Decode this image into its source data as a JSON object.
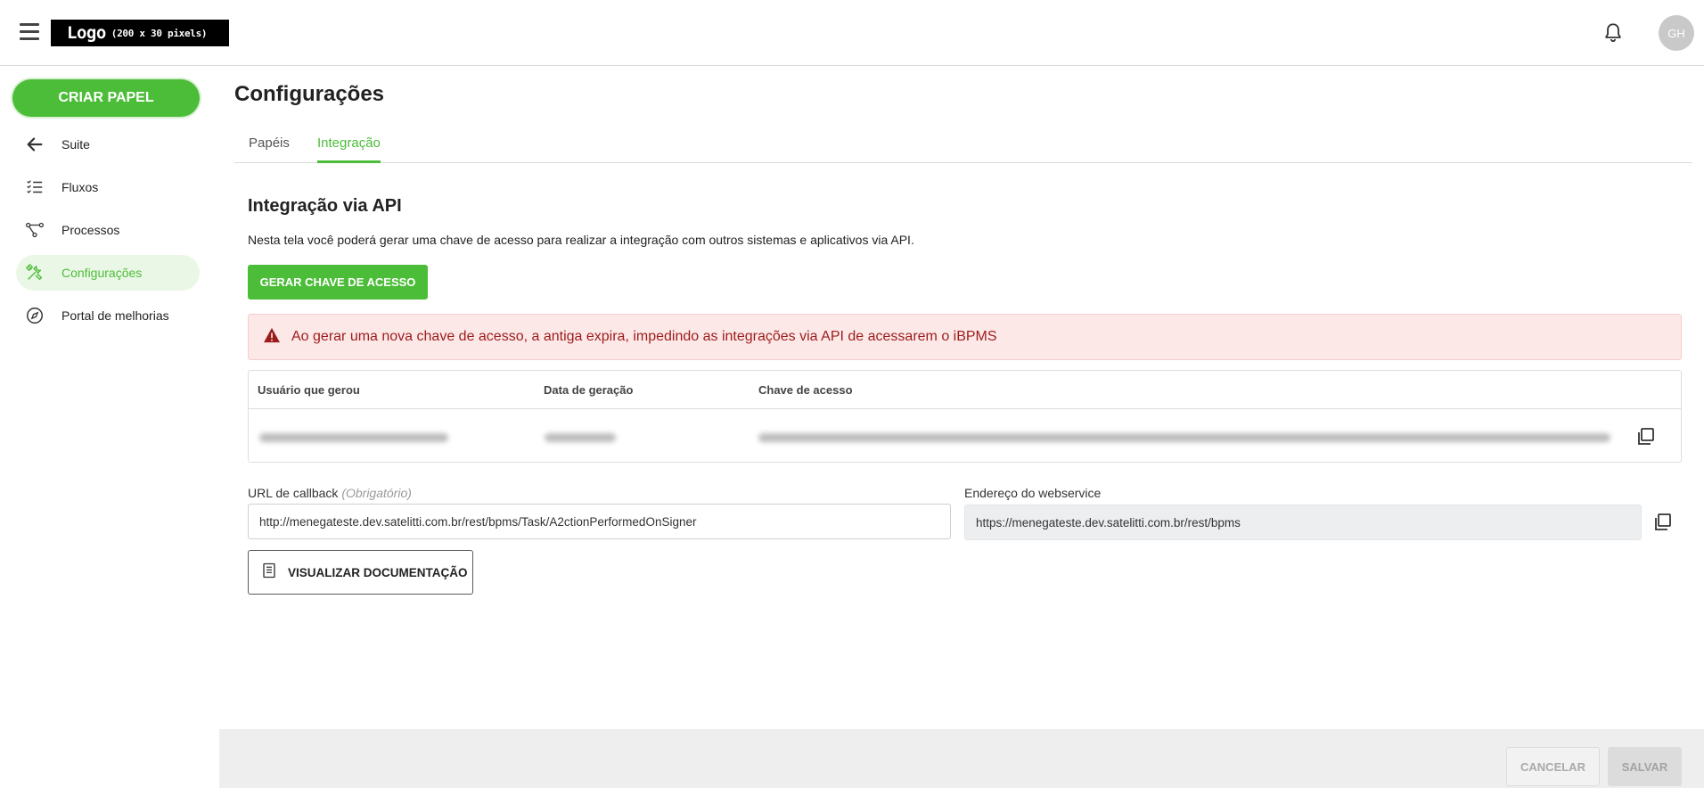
{
  "header": {
    "logo_main": "Logo",
    "logo_sub": "(200 x 30 pixels)",
    "avatar_initials": "GH"
  },
  "sidebar": {
    "create_button": "CRIAR PAPEL",
    "items": [
      {
        "label": "Suite",
        "icon": "arrow-left-icon"
      },
      {
        "label": "Fluxos",
        "icon": "checklist-icon"
      },
      {
        "label": "Processos",
        "icon": "process-flow-icon"
      },
      {
        "label": "Configurações",
        "icon": "tools-icon",
        "active": true
      },
      {
        "label": "Portal de melhorias",
        "icon": "compass-icon"
      }
    ]
  },
  "main": {
    "title": "Configurações",
    "tabs": [
      {
        "label": "Papéis",
        "active": false
      },
      {
        "label": "Integração",
        "active": true
      }
    ],
    "section_title": "Integração via API",
    "description": "Nesta tela você poderá gerar uma chave de acesso para realizar a integração com outros sistemas e aplicativos via API.",
    "generate_button": "GERAR CHAVE DE ACESSO",
    "alert_text": "Ao gerar uma nova chave de acesso, a antiga expira, impedindo as integrações via API de acessarem o iBPMS",
    "table": {
      "columns": [
        "Usuário que gerou",
        "Data de geração",
        "Chave de acesso"
      ]
    },
    "callback": {
      "label": "URL de callback",
      "required_hint": "(Obrigatório)",
      "value": "http://menegateste.dev.satelitti.com.br/rest/bpms/Task/A2ctionPerformedOnSigner"
    },
    "webservice": {
      "label": "Endereço do webservice",
      "value": "https://menegateste.dev.satelitti.com.br/rest/bpms"
    },
    "doc_button": "VISUALIZAR DOCUMENTAÇÃO"
  },
  "footer": {
    "cancel": "CANCELAR",
    "save": "SALVAR"
  },
  "colors": {
    "accent": "#4cbd38",
    "alert_bg": "#fde8e8",
    "alert_text": "#9c1c1c"
  }
}
